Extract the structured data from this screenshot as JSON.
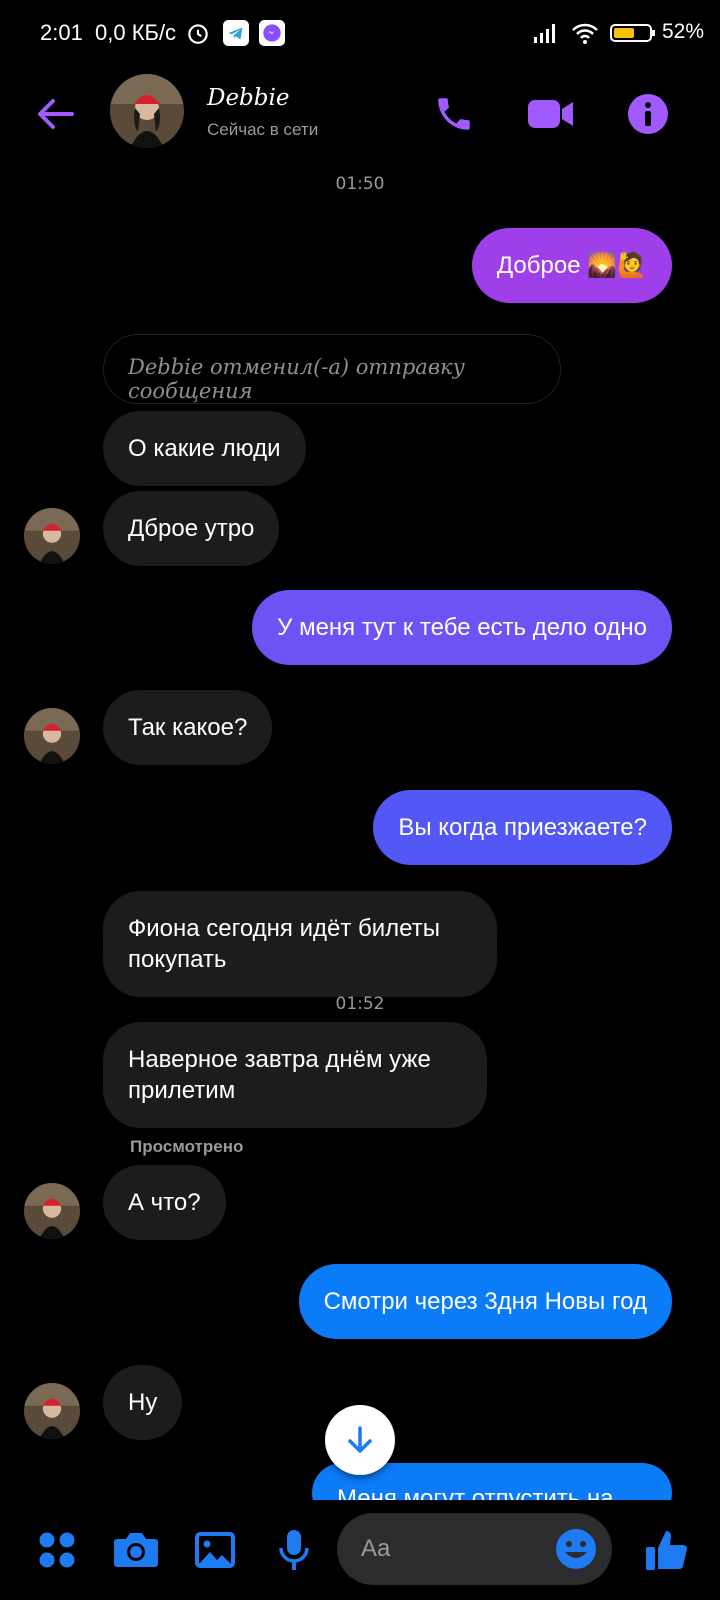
{
  "status_bar": {
    "time": "2:01",
    "net_speed": "0,0 КБ/с",
    "battery": "52%"
  },
  "header": {
    "name": "Debbie",
    "status": "Сейчас в сети"
  },
  "messages": {
    "time1": "01:50",
    "m1": "Доброе 🌄🙋",
    "unsent": "Debbie отменил(-а) отправку сообщения",
    "m2": "О какие люди",
    "m3": "Дброе утро",
    "m4": "У меня тут к тебе есть дело одно",
    "m5": "Так какое?",
    "m6": "Вы когда приезжаете?",
    "m7": "Фиона сегодня идёт билеты покупать",
    "time2": "01:52",
    "m8": "Наверное завтра днём уже прилетим",
    "seen": "Просмотрено",
    "m9": "А что?",
    "m10": "Смотри через 3дня Новы год",
    "m11": "Ну",
    "m12": "Меня могут отпустить на"
  },
  "composer": {
    "placeholder": "Aa"
  },
  "colors": {
    "accent": "#a259ff",
    "bubble_purple": "#9f3fea",
    "bubble_violet": "#6d53f3",
    "bubble_indigo": "#5357f5",
    "bubble_blue": "#0b7bf7",
    "composer_blue": "#1f7bf2"
  }
}
